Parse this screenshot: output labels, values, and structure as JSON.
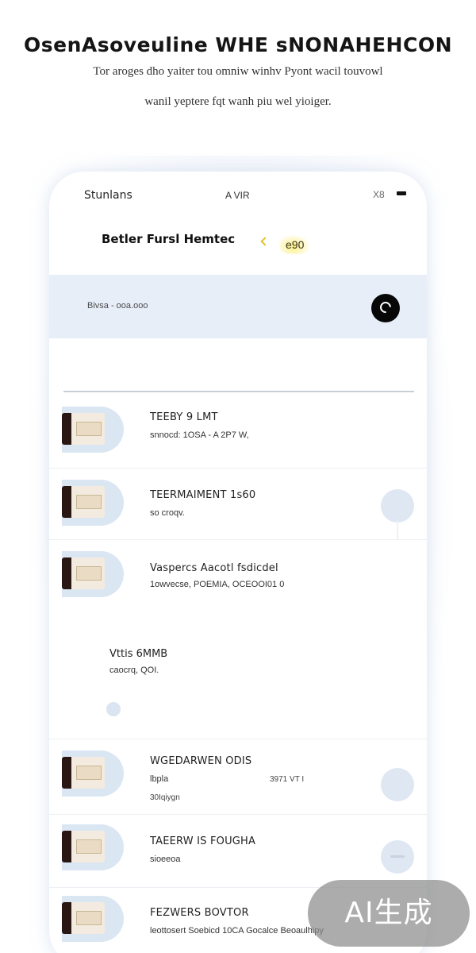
{
  "hero": {
    "title": "OsenAsoveuline WHE sNONAHEHCON",
    "subtitle_line1": "Tor aroges dho yaiter tou omniw winhv Pyont wacil touvowl",
    "subtitle_line2": "wanil yeptere fqt wanh piu wel yioiger."
  },
  "status_bar": {
    "left": "Stunlans",
    "center": "A VIR",
    "right": "X8"
  },
  "header": {
    "title": "Betler Fursl Hemtec",
    "coins": "e90"
  },
  "balance": {
    "label": "Bivsa - ooa.ooo"
  },
  "items": [
    {
      "title": "TEEBY 9 LMT",
      "subtitle": "snnocd: 1OSA - A 2P7 W,"
    },
    {
      "title": "TEERMAIMENT 1s60",
      "subtitle": "so croqv."
    },
    {
      "title": "Vaspercs Aacotl fsdicdel",
      "subtitle": "1owvecse, POEMIA, OCEOOI01 0"
    },
    {
      "title": "WGEDARWEN ODIS",
      "subtitle": "lbpla",
      "subtitle_right": "3971 VT I",
      "subtitle2": "30Iqiygn"
    },
    {
      "title": "TAEERW IS FOUGHA",
      "subtitle": "sioeeoa"
    },
    {
      "title": "FEZWERS BOVTOR",
      "subtitle": "leottosert Soebicd 10CA Gocalce Beoaulhipy"
    }
  ],
  "section": {
    "title": "Vttis 6MMB",
    "subtitle": "caocrq, QOI."
  },
  "watermark": "AI生成"
}
